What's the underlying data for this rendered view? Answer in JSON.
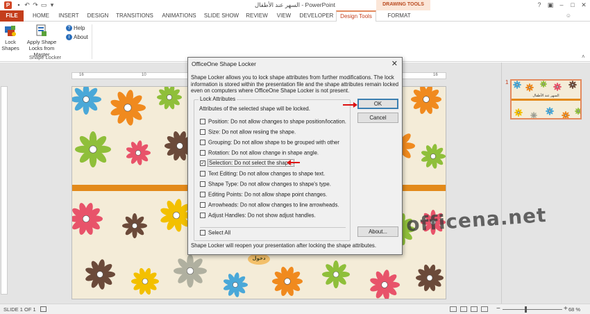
{
  "window": {
    "title": "السهر عند الأطفال - PowerPoint",
    "contextual_label": "DRAWING TOOLS"
  },
  "tabs": [
    {
      "label": "FILE"
    },
    {
      "label": "HOME"
    },
    {
      "label": "INSERT"
    },
    {
      "label": "DESIGN"
    },
    {
      "label": "TRANSITIONS"
    },
    {
      "label": "ANIMATIONS"
    },
    {
      "label": "SLIDE SHOW"
    },
    {
      "label": "REVIEW"
    },
    {
      "label": "VIEW"
    },
    {
      "label": "DEVELOPER"
    },
    {
      "label": "Design Tools"
    },
    {
      "label": "FORMAT"
    }
  ],
  "ribbon": {
    "lock_shapes": "Lock Shapes",
    "apply_shape_locks": "Apply Shape Locks from Master",
    "help": "Help",
    "about": "About",
    "group_label": "Shape Locker"
  },
  "slide": {
    "button_text": "دخول",
    "thumbnail_number": "1",
    "thumbnail_text": "السهر عند الأطفال"
  },
  "watermark": "officena.net",
  "dialog": {
    "title": "OfficeOne Shape Locker",
    "description": "Shape Locker allows you to lock shape attributes from further modifications. The lock information is stored within the presentation file and the shape attributes remain locked even on computers where OfficeOne Shape Locker is not present.",
    "group_title": "Lock Attributes",
    "group_subtitle": "Attributes of the selected shape will be locked.",
    "options": [
      {
        "label": "Position: Do not allow changes to shape position/location.",
        "checked": false
      },
      {
        "label": "Size: Do not allow resiing the shape.",
        "checked": false
      },
      {
        "label": "Grouping: Do not allow shape to be grouped with other",
        "checked": false
      },
      {
        "label": "Rotation: Do not allow change in shape angle.",
        "checked": false
      },
      {
        "label": "Selection: Do not select the shape.",
        "checked": true
      },
      {
        "label": "Text Editing: Do not allow changes to shape text.",
        "checked": false
      },
      {
        "label": "Shape Type: Do not allow changes to shape's type.",
        "checked": false
      },
      {
        "label": "Editing Points: Do not allow shape point changes.",
        "checked": false
      },
      {
        "label": "Arrowheads: Do not allow changes to line arrowheads.",
        "checked": false
      },
      {
        "label": "Adjust Handles: Do not show adjust handles.",
        "checked": false
      }
    ],
    "select_all": "Select All",
    "ok": "OK",
    "cancel": "Cancel",
    "about": "About...",
    "footer": "Shape Locker will reopen your presentation after locking the shape attributes."
  },
  "status": {
    "slide_count": "SLIDE 1 OF 1",
    "zoom": "68 %"
  },
  "colors": {
    "accent": "#c43e1c",
    "band": "#e38a1a",
    "slide_bg": "#f4ecd8",
    "arrow": "#dd1111"
  }
}
